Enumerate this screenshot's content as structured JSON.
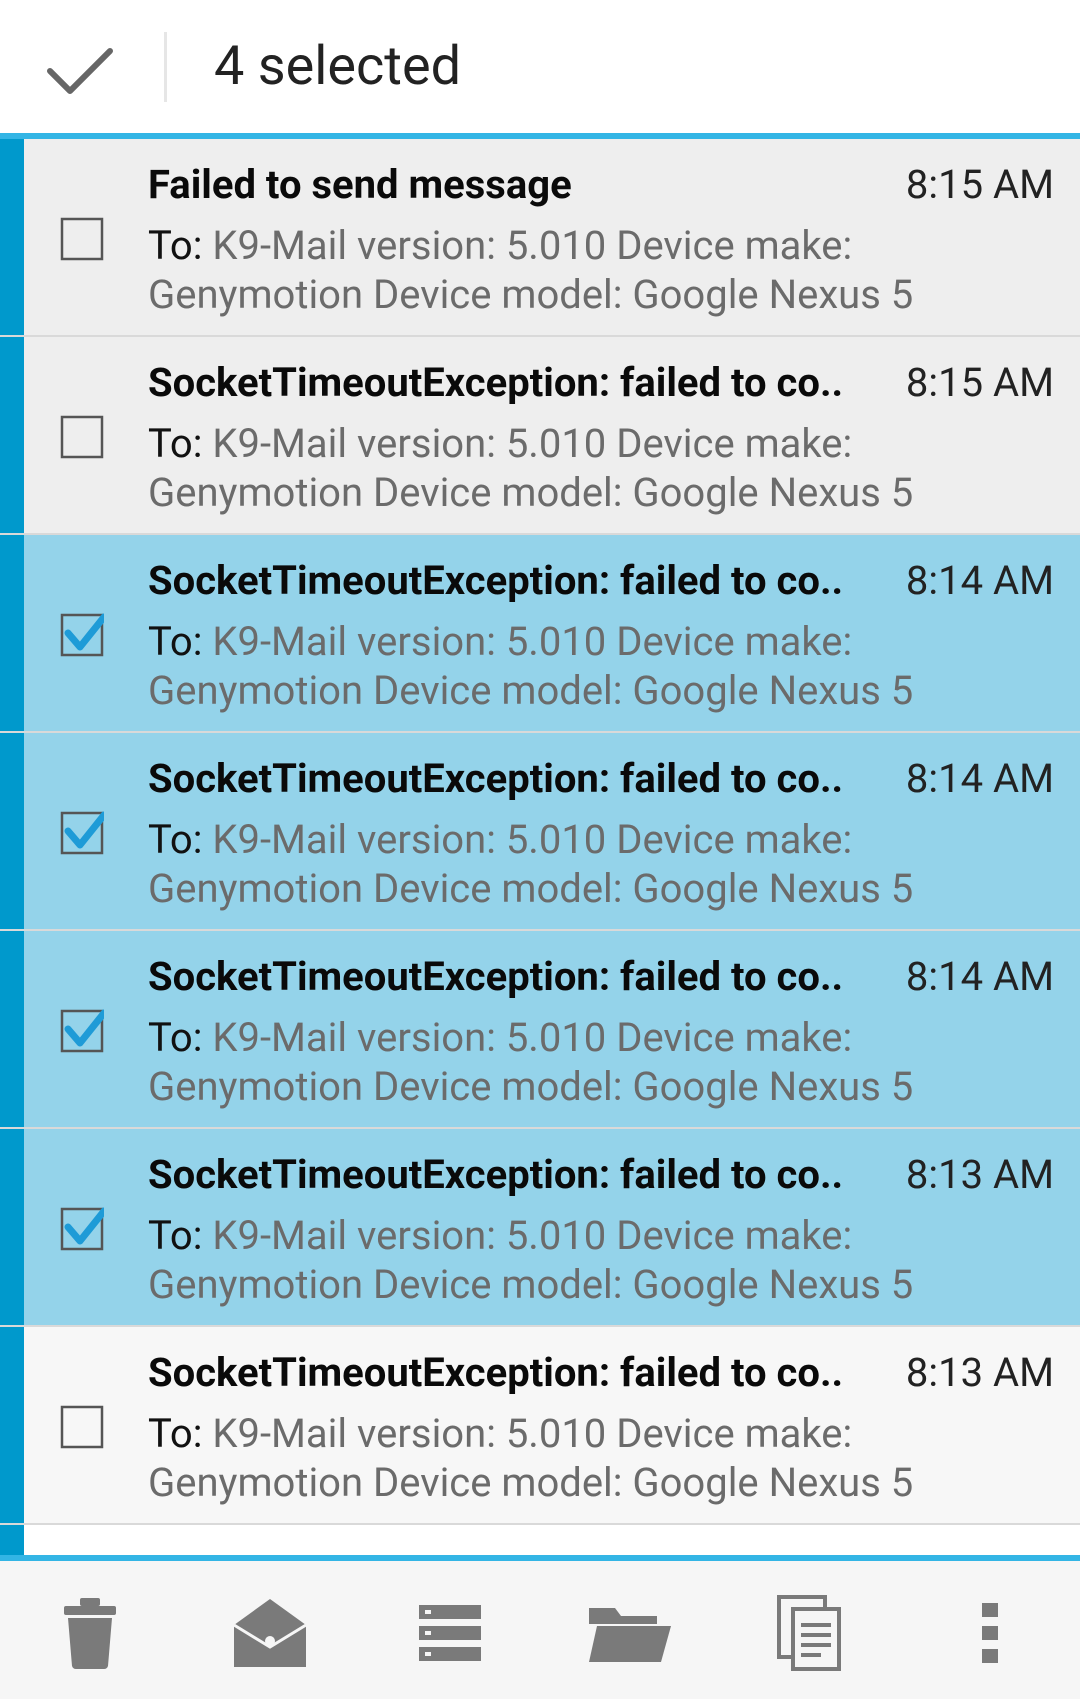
{
  "action_bar": {
    "done_icon": "checkmark-icon",
    "title": "4 selected",
    "accent": "#33b5e5"
  },
  "messages": [
    {
      "subject": "Failed to send message",
      "time": "8:15 AM",
      "to_label": "To:",
      "preview_line1": "K9-Mail version: 5.010 Device make:",
      "preview_line2": "Genymotion Device model: Google Nexus 5",
      "checked": false
    },
    {
      "subject": "SocketTimeoutException: failed to co..",
      "time": "8:15 AM",
      "to_label": "To:",
      "preview_line1": "K9-Mail version: 5.010 Device make:",
      "preview_line2": "Genymotion Device model: Google Nexus 5",
      "checked": false
    },
    {
      "subject": "SocketTimeoutException: failed to co..",
      "time": "8:14 AM",
      "to_label": "To:",
      "preview_line1": "K9-Mail version: 5.010 Device make:",
      "preview_line2": "Genymotion Device model: Google Nexus 5",
      "checked": true
    },
    {
      "subject": "SocketTimeoutException: failed to co..",
      "time": "8:14 AM",
      "to_label": "To:",
      "preview_line1": "K9-Mail version: 5.010 Device make:",
      "preview_line2": "Genymotion Device model: Google Nexus 5",
      "checked": true
    },
    {
      "subject": "SocketTimeoutException: failed to co..",
      "time": "8:14 AM",
      "to_label": "To:",
      "preview_line1": "K9-Mail version: 5.010 Device make:",
      "preview_line2": "Genymotion Device model: Google Nexus 5",
      "checked": true
    },
    {
      "subject": "SocketTimeoutException: failed to co..",
      "time": "8:13 AM",
      "to_label": "To:",
      "preview_line1": "K9-Mail version: 5.010 Device make:",
      "preview_line2": "Genymotion Device model: Google Nexus 5",
      "checked": true
    },
    {
      "subject": "SocketTimeoutException: failed to co..",
      "time": "8:13 AM",
      "to_label": "To:",
      "preview_line1": "K9-Mail version: 5.010 Device make:",
      "preview_line2": "Genymotion Device model: Google Nexus 5",
      "checked": false
    }
  ],
  "bottom_actions": [
    {
      "icon": "delete-icon"
    },
    {
      "icon": "mark-read-icon"
    },
    {
      "icon": "archive-icon"
    },
    {
      "icon": "move-folder-icon"
    },
    {
      "icon": "copy-icon"
    },
    {
      "icon": "overflow-menu-icon"
    }
  ],
  "colors": {
    "chip": "#0099cc",
    "selected_row": "#94d3ea",
    "unselected_row": "#eeeeee",
    "checkbox_checked": "#1e9bd7"
  }
}
